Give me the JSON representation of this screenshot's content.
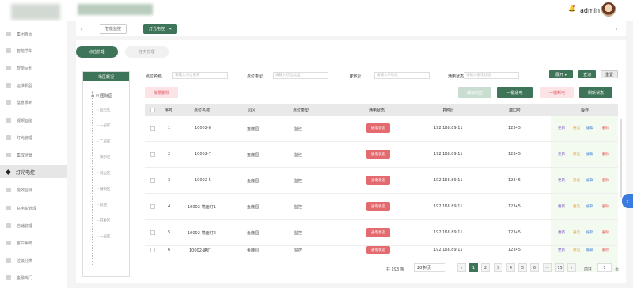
{
  "header": {
    "user": "admin"
  },
  "sidebar": {
    "items": [
      {
        "label": "集团首页"
      },
      {
        "label": "智能停车"
      },
      {
        "label": "智能wifi"
      },
      {
        "label": "运维机器"
      },
      {
        "label": "信息发布"
      },
      {
        "label": "视频智能"
      },
      {
        "label": "灯光管理"
      },
      {
        "label": "集成场景"
      },
      {
        "label": "灯光电控"
      },
      {
        "label": "能效监测"
      },
      {
        "label": "充电车管理"
      },
      {
        "label": "店铺管理"
      },
      {
        "label": "客户系统"
      },
      {
        "label": "垃圾分类"
      },
      {
        "label": "金融专门"
      }
    ]
  },
  "tabs": [
    {
      "label": "智能监控"
    },
    {
      "label": "灯光电控"
    }
  ],
  "subtabs": {
    "active": "点位管理",
    "inactive": "任务管理"
  },
  "tree": {
    "header": "场区概况",
    "root": "国际园",
    "children": [
      "监控区",
      "一层区",
      "二层区",
      "演示区",
      "周边区",
      "展销区",
      "其他",
      "开发区",
      "一层区"
    ]
  },
  "filters": {
    "name_label": "点位名称:",
    "name_placeholder": "请输入点位名称",
    "type_label": "点位类型:",
    "type_placeholder": "请输入点位类型",
    "ip_label": "IP地址:",
    "ip_placeholder": "请输入IP地址",
    "status_label": "通电状态:",
    "status_placeholder": "请输入通电状态",
    "expand_btn": "展开 ▾",
    "search_btn": "查询",
    "reset_btn": "重置"
  },
  "actions": {
    "batch_delete": "批量删除",
    "add_point": "增加点位",
    "power_on_all": "一键通电",
    "power_off_all": "一键断电",
    "refresh_status": "刷新状态"
  },
  "table": {
    "columns": [
      "序号",
      "点位名称",
      "园区",
      "点位类型",
      "通电状态",
      "IP地址",
      "端口号",
      "操作"
    ],
    "rows": [
      {
        "no": "1",
        "name": "10002-8",
        "park": "鱼鹿园",
        "type": "监控",
        "status": "通电状态",
        "ip": "192.168.89.11",
        "port": "12345"
      },
      {
        "no": "2",
        "name": "10002-7",
        "park": "鱼鹿园",
        "type": "监控",
        "status": "通电状态",
        "ip": "192.168.89.11",
        "port": "12345"
      },
      {
        "no": "3",
        "name": "10002-5",
        "park": "鱼鹿园",
        "type": "监控",
        "status": "通电状态",
        "ip": "192.168.89.11",
        "port": "12345"
      },
      {
        "no": "4",
        "name": "10002-墙面灯1",
        "park": "鱼鹿园",
        "type": "监控",
        "status": "通电状态",
        "ip": "192.168.89.11",
        "port": "12345"
      },
      {
        "no": "5",
        "name": "10002-墙面灯2",
        "park": "鱼鹿园",
        "type": "监控",
        "status": "通电状态",
        "ip": "192.168.89.11",
        "port": "12345"
      },
      {
        "no": "6",
        "name": "10002-路灯",
        "park": "鱼鹿园",
        "type": "监控",
        "status": "通电状态",
        "ip": "192.168.89.11",
        "port": "12345"
      }
    ],
    "ops": [
      "更新",
      "通电",
      "编辑",
      "删除"
    ]
  },
  "pagination": {
    "total": "共 293 条",
    "page_size": "20条/页",
    "pages": [
      "1",
      "2",
      "3",
      "4",
      "5",
      "6",
      "···",
      "15"
    ],
    "goto_label": "前往",
    "goto_value": "1",
    "page_unit": "页"
  }
}
